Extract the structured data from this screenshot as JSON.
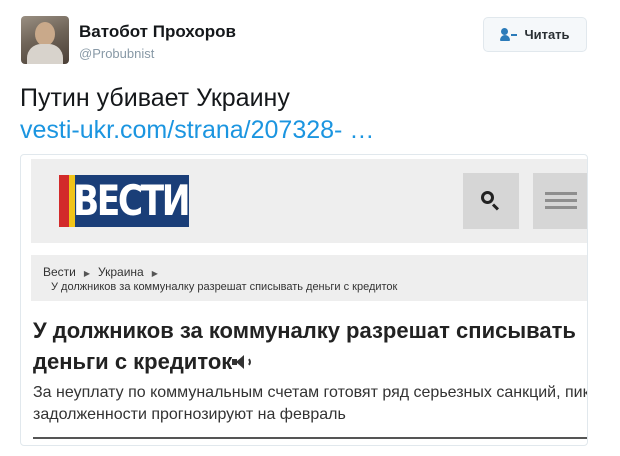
{
  "author": {
    "name": "Ватобот Прохоров",
    "handle": "@Probubnist"
  },
  "follow_button": {
    "label": "Читать",
    "icon": "add-user-icon"
  },
  "tweet": {
    "text": "Путин убивает Украину",
    "link_text": "vesti-ukr.com/strana/207328- …"
  },
  "card": {
    "site_logo_text": "ВЕСТИ",
    "breadcrumb": {
      "items": [
        "Вести",
        "Украина"
      ],
      "current": "У должников за коммуналку разрешат списывать деньги с кредиток"
    },
    "headline": "У должников за коммуналку разрешат списывать деньги с кредиток",
    "lead": "За неуплату по коммунальным счетам готовят ряд серьезных санкций, пик задолженности прогнозируют на февраль"
  },
  "colors": {
    "link": "#1b95e0",
    "logo_bg": "#1a3e78",
    "logo_red": "#d22a2a",
    "logo_yellow": "#f0c419"
  }
}
